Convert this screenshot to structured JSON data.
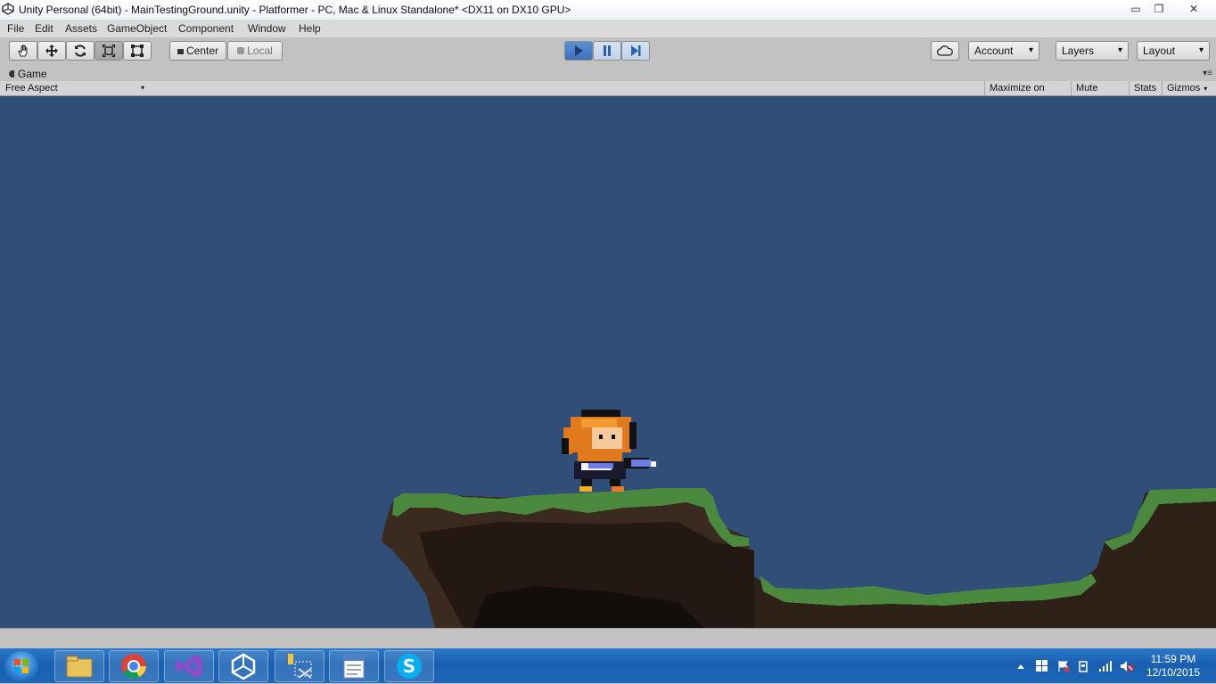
{
  "window": {
    "title": "Unity Personal (64bit) - MainTestingGround.unity - Platformer - PC, Mac & Linux Standalone* <DX11 on DX10 GPU>",
    "minimize": "▭",
    "restore": "❐",
    "close": "✕"
  },
  "menu": [
    "File",
    "Edit",
    "Assets",
    "GameObject",
    "Component",
    "Window",
    "Help"
  ],
  "toolbar": {
    "tools": [
      "hand-icon",
      "move-icon",
      "rotate-icon",
      "scale-icon",
      "rect-icon"
    ],
    "pivot_center": "Center",
    "pivot_local": "Local",
    "play_state": "playing",
    "account": "Account",
    "layers": "Layers",
    "layout": "Layout"
  },
  "game_tab": {
    "label": "Game",
    "aspect": "Free Aspect",
    "maximize_on_play": "Maximize on Play",
    "mute_audio": "Mute audio",
    "stats": "Stats",
    "gizmos": "Gizmos"
  },
  "scene_colors": {
    "sky": "#314e78",
    "grass": "#4b8a3e",
    "dirt": "#3a2a20",
    "dirt_dark": "#241912"
  },
  "taskbar": {
    "apps": [
      "explorer-icon",
      "chrome-icon",
      "visual-studio-icon",
      "unity-icon",
      "snipping-tool-icon",
      "wordpad-icon",
      "skype-icon"
    ],
    "time": "11:59 PM",
    "date": "12/10/2015"
  }
}
